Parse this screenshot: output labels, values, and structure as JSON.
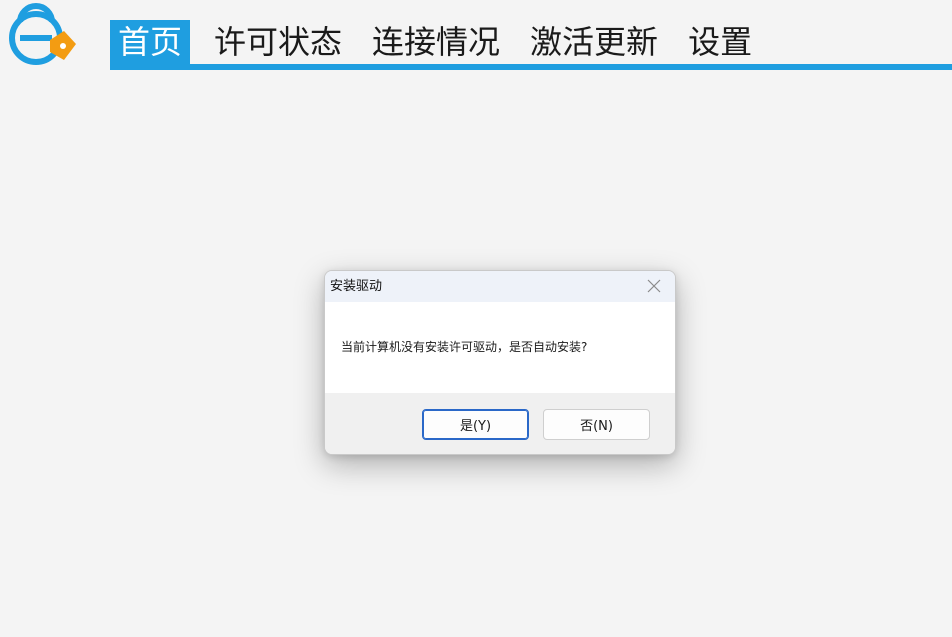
{
  "app": {
    "logo_icon": "lock-badge-icon",
    "colors": {
      "accent": "#1f9ee0",
      "logo_orange": "#f39c12",
      "background": "#f4f4f4"
    }
  },
  "nav": {
    "tabs": [
      {
        "label": "首页",
        "active": true
      },
      {
        "label": "许可状态",
        "active": false
      },
      {
        "label": "连接情况",
        "active": false
      },
      {
        "label": "激活更新",
        "active": false
      },
      {
        "label": "设置",
        "active": false
      }
    ]
  },
  "dialog": {
    "title": "安装驱动",
    "close_icon": "close-icon",
    "message": "当前计算机没有安装许可驱动，是否自动安装?",
    "yes_label": "是(Y)",
    "no_label": "否(N)"
  }
}
